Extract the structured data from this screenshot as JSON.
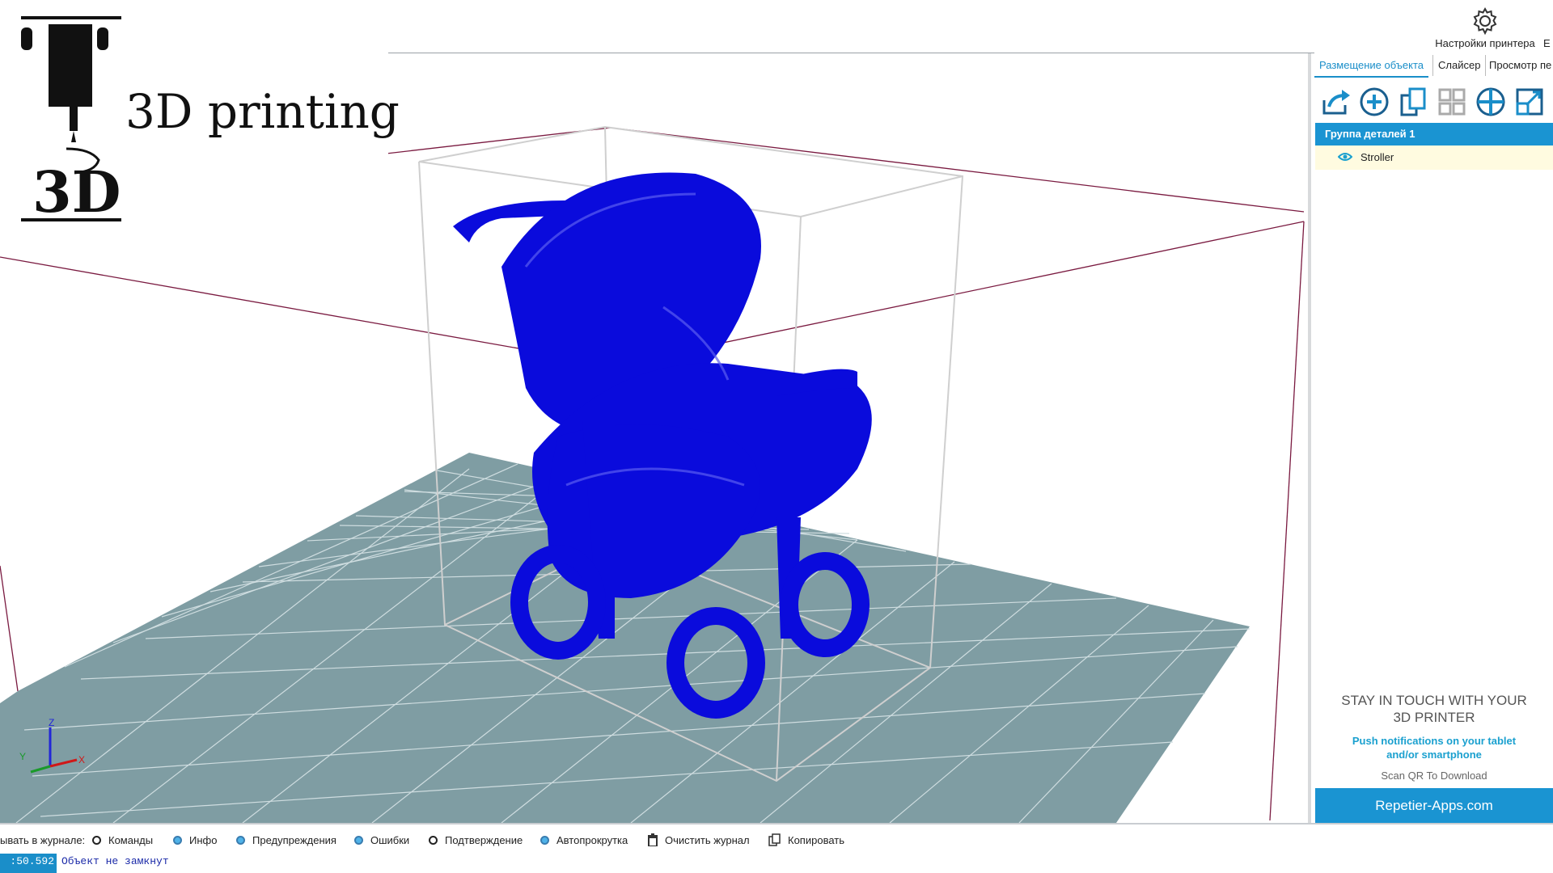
{
  "topbar": {
    "printer_settings_label": "Настройки принтера",
    "cut_label": "E"
  },
  "logo": {
    "text": "3D printing",
    "mark_text": "3D"
  },
  "viewport": {
    "background": "#ffffff",
    "bed_color": "#7f9da3",
    "object_color": "#0a0bdc",
    "object_name": "Stroller",
    "axes": {
      "x": "X",
      "y": "Y",
      "z": "Z"
    }
  },
  "panel": {
    "tabs": [
      "Размещение объекта",
      "Слайсер",
      "Просмотр пе"
    ],
    "toolbar_icons": [
      "export-icon",
      "add-object-icon",
      "copy-icon",
      "autoplace-icon",
      "center-icon",
      "scale-icon"
    ],
    "group_header": "Группа деталей 1",
    "object_row": "Stroller",
    "promo": {
      "title": "STAY IN TOUCH WITH YOUR 3D PRINTER",
      "subtitle": "Push notifications on your tablet and/or smartphone",
      "scan": "Scan QR To Download",
      "button": "Repetier-Apps.com"
    }
  },
  "log": {
    "filters_label": "ывать в журнале:",
    "filters": [
      {
        "label": "Команды",
        "checked": false
      },
      {
        "label": "Инфо",
        "checked": true
      },
      {
        "label": "Предупреждения",
        "checked": true
      },
      {
        "label": "Ошибки",
        "checked": true
      },
      {
        "label": "Подтверждение",
        "checked": false
      },
      {
        "label": "Автопрокрутка",
        "checked": true
      }
    ],
    "clear_label": "Очистить журнал",
    "copy_label": "Копировать",
    "time": ":50.592",
    "message": "Объект не замкнут"
  },
  "colors": {
    "accent": "#1a94d2",
    "object": "#0a0bdc",
    "bed": "#7f9da3"
  }
}
